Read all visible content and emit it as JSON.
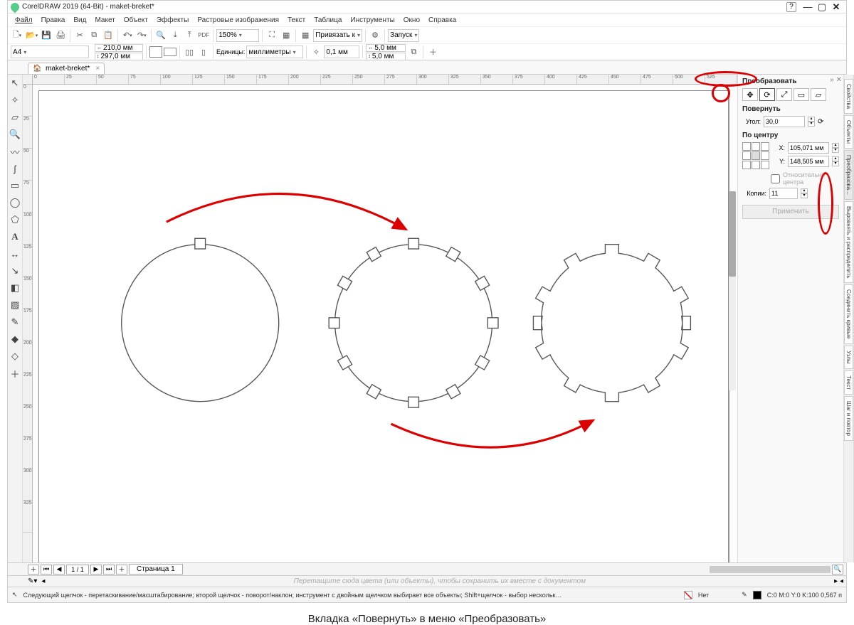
{
  "app": {
    "title": "CorelDRAW 2019 (64-Bit) - maket-breket*"
  },
  "menu": [
    "Файл",
    "Правка",
    "Вид",
    "Макет",
    "Объект",
    "Эффекты",
    "Растровые изображения",
    "Текст",
    "Таблица",
    "Инструменты",
    "Окно",
    "Справка"
  ],
  "toolbar1": {
    "zoom": "150%",
    "snap_label": "Привязать к",
    "launch_label": "Запуск",
    "pdf_label": "PDF"
  },
  "propbar": {
    "page_preset": "A4",
    "width": "210,0 мм",
    "height": "297,0 мм",
    "units_label": "Единицы:",
    "units_value": "миллиметры",
    "nudge": "0,1 мм",
    "dup_x": "5,0 мм",
    "dup_y": "5,0 мм"
  },
  "doc_tab": "maket-breket*",
  "ruler_h": [
    "0",
    "25",
    "50",
    "75",
    "100",
    "125",
    "150",
    "175",
    "200",
    "225",
    "250",
    "275",
    "300",
    "325",
    "350",
    "375",
    "400",
    "425",
    "450",
    "475",
    "500",
    "525"
  ],
  "ruler_v": [
    "0",
    "25",
    "50",
    "75",
    "100",
    "125",
    "150",
    "175",
    "200",
    "225",
    "250",
    "275",
    "300",
    "325"
  ],
  "docker": {
    "panel_title": "Преобразовать",
    "rotate_hdr": "Повернуть",
    "angle_label": "Угол:",
    "angle_value": "30,0",
    "center_hdr": "По центру",
    "x_label": "X:",
    "x_value": "105,071 мм",
    "y_label": "Y:",
    "y_value": "148,505 мм",
    "relcenter_label": "Относительно центра",
    "copies_label": "Копии:",
    "copies_value": "11",
    "apply_label": "Применить"
  },
  "vtabs": [
    "Свойства",
    "Объекты",
    "Преобразова...",
    "Выровнять и распределить",
    "Соединить кривые",
    "Узлы",
    "Текст",
    "Шаг и повтор"
  ],
  "palette_colors": [
    "#ffffff",
    "#000000",
    "#002d5a",
    "#1b3e8b",
    "#0057a8",
    "#0076c0",
    "#009fd6",
    "#005e3a",
    "#008a3a",
    "#6abf4b",
    "#e3002b",
    "#ef7b00",
    "#f6a800",
    "#7a3f1c",
    "#c6006f",
    "#7e3f98",
    "#a0d8ef",
    "#bcdc8c",
    "#f7c6d9",
    "#c6a0d8",
    "#dcdcdc",
    "#b5b5b5",
    "#8c8c8c",
    "#5e5e5e"
  ],
  "page_tabs": {
    "page1": "Страница 1"
  },
  "hint_row": "Перетащите сюда цвета (или объекты), чтобы сохранить их вместе с документом",
  "status": {
    "tooltip": "Следующий щелчок - перетаскивание/масштабирование; второй щелчок - поворот/наклон; инструмент с двойным щелчком выбирает все объекты; Shift+щелчок - выбор нескольких элементов; Alt+щелчок - цифры",
    "fill_none_label": "Нет",
    "cmyk_label": "C:0 M:0 Y:0 K:100 0,567 п"
  },
  "caption": "Вкладка «Повернуть» в меню «Преобразовать»"
}
